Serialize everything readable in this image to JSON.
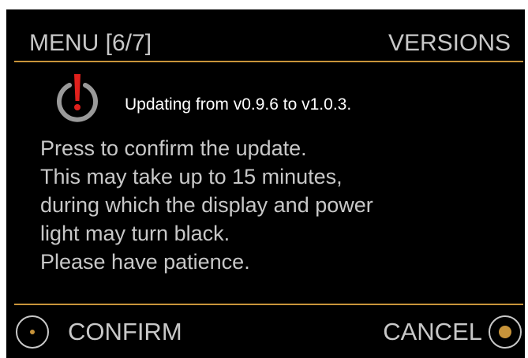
{
  "header": {
    "menu_title": "MENU [6/7]",
    "section_title": "VERSIONS"
  },
  "update": {
    "icon": "power-warning-icon",
    "message": "Updating from v0.9.6 to v1.0.3."
  },
  "body": {
    "lines": [
      "Press to confirm the update.",
      "This may take up to 15 minutes,",
      "during which the display and power",
      "light may turn black.",
      "Please have patience."
    ]
  },
  "footer": {
    "confirm_label": "CONFIRM",
    "cancel_label": "CANCEL"
  },
  "colors": {
    "background": "#000000",
    "text": "#c8c8c8",
    "accent": "#c8943a",
    "warning": "#e0201c"
  }
}
